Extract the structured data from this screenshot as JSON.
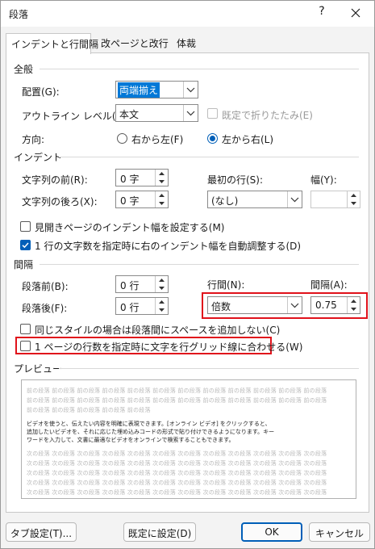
{
  "window": {
    "title": "段落",
    "help": "?"
  },
  "tabs": [
    "インデントと行間隔",
    "改ページと改行",
    "体裁"
  ],
  "general": {
    "heading": "全般",
    "alignment_label": "配置(G):",
    "alignment_value": "両端揃え",
    "outline_label": "アウトライン レベル(O):",
    "outline_value": "本文",
    "collapse_label": "既定で折りたたみ(E)",
    "direction_label": "方向:",
    "rtl_label": "右から左(F)",
    "ltr_label": "左から右(L)"
  },
  "indent": {
    "heading": "インデント",
    "before_label": "文字列の前(R):",
    "before_value": "0 字",
    "after_label": "文字列の後ろ(X):",
    "after_value": "0 字",
    "first_line_label": "最初の行(S):",
    "first_line_value": "(なし)",
    "width_label": "幅(Y):",
    "width_value": "",
    "mirror_label": "見開きページのインデント幅を設定する(M)",
    "auto_adjust_label": "1 行の文字数を指定時に右のインデント幅を自動調整する(D)"
  },
  "spacing": {
    "heading": "間隔",
    "before_label": "段落前(B):",
    "before_value": "0 行",
    "after_label": "段落後(F):",
    "after_value": "0 行",
    "line_label": "行間(N):",
    "line_value": "倍数",
    "at_label": "間隔(A):",
    "at_value": "0.75",
    "no_space_same_style_label": "同じスタイルの場合は段落間にスペースを追加しない(C)",
    "snap_to_grid_label": "1 ページの行数を指定時に文字を行グリッド線に合わせる(W)"
  },
  "preview": {
    "heading": "プレビュー",
    "prev_lines": [
      "前の段落 前の段落 前の段落 前の段落 前の段落 前の段落 前の段落 前の段落 前の段落 前の段落 前の段落 前の段落",
      "前の段落 前の段落 前の段落 前の段落 前の段落 前の段落 前の段落 前の段落 前の段落 前の段落 前の段落 前の段落",
      "前の段落 前の段落 前の段落 前の段落 前の段落"
    ],
    "sample_lines": [
      "ビデオを使うと、伝えたい内容を明確に表現できます。[オンライン ビデオ] をクリックすると、",
      "追加したいビデオを、それに応じた埋め込みコードの形式で貼り付けできるようになります。キー",
      "ワードを入力して、文書に最適なビデオをオンラインで検索することもできます。"
    ],
    "next_lines": [
      "次の段落 次の段落 次の段落 次の段落 次の段落 次の段落 次の段落 次の段落 次の段落 次の段落 次の段落 次の段落",
      "次の段落 次の段落 次の段落 次の段落 次の段落 次の段落 次の段落 次の段落 次の段落 次の段落 次の段落 次の段落",
      "次の段落 次の段落 次の段落 次の段落 次の段落 次の段落 次の段落 次の段落 次の段落 次の段落 次の段落 次の段落",
      "次の段落 次の段落 次の段落 次の段落 次の段落 次の段落 次の段落 次の段落 次の段落 次の段落 次の段落 次の段落",
      "次の段落 次の段落 次の段落 次の段落 次の段落 次の段落 次の段落 次の段落 次の段落 次の段落 次の段落 次の段落"
    ]
  },
  "buttons": {
    "tabs": "タブ設定(T)...",
    "default": "既定に設定(D)",
    "ok": "OK",
    "cancel": "キャンセル"
  },
  "colors": {
    "accent": "#005fb8",
    "highlight_box": "#e0121b",
    "selection": "#0078d7"
  }
}
